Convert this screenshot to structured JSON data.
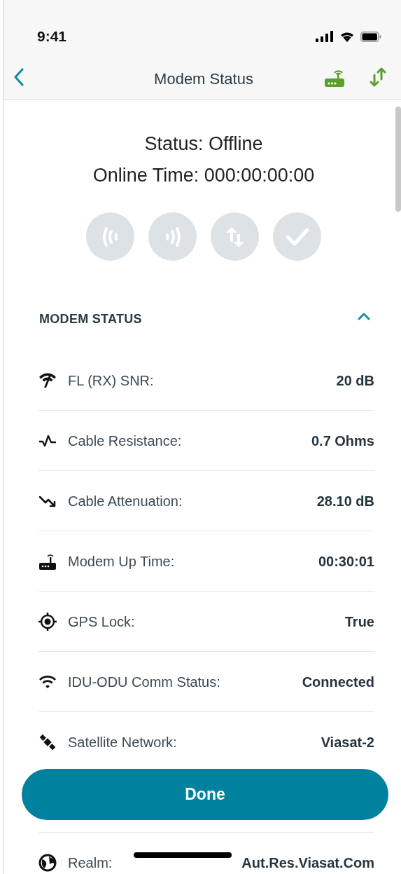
{
  "status_bar": {
    "time": "9:41"
  },
  "nav": {
    "title": "Modem Status"
  },
  "summary": {
    "status": "Status: Offline",
    "online_time": "Online Time: 000:00:00:00"
  },
  "stage_icons": [
    {
      "kind": "signal-left",
      "active": false
    },
    {
      "kind": "signal-right",
      "active": false
    },
    {
      "kind": "transfer",
      "active": false
    },
    {
      "kind": "check",
      "active": false
    }
  ],
  "section": {
    "title": "MODEM STATUS",
    "expanded": true
  },
  "rows": [
    {
      "kind": "snr",
      "label": "FL (RX) SNR:",
      "value": "20 dB"
    },
    {
      "kind": "pulse",
      "label": "Cable Resistance:",
      "value": "0.7 Ohms"
    },
    {
      "kind": "trend",
      "label": "Cable Attenuation:",
      "value": "28.10 dB"
    },
    {
      "kind": "router",
      "label": "Modem Up Time:",
      "value": "00:30:01"
    },
    {
      "kind": "target",
      "label": "GPS Lock:",
      "value": "True"
    },
    {
      "kind": "wifi",
      "label": "IDU-ODU Comm Status:",
      "value": "Connected"
    },
    {
      "kind": "satellite",
      "label": "Satellite Network:",
      "value": "Viasat-2"
    },
    {
      "kind": "hidden"
    },
    {
      "kind": "globe",
      "label": "Realm:",
      "value": "Aut.Res.Viasat.Com",
      "redacted": true
    }
  ],
  "done_button": "Done"
}
